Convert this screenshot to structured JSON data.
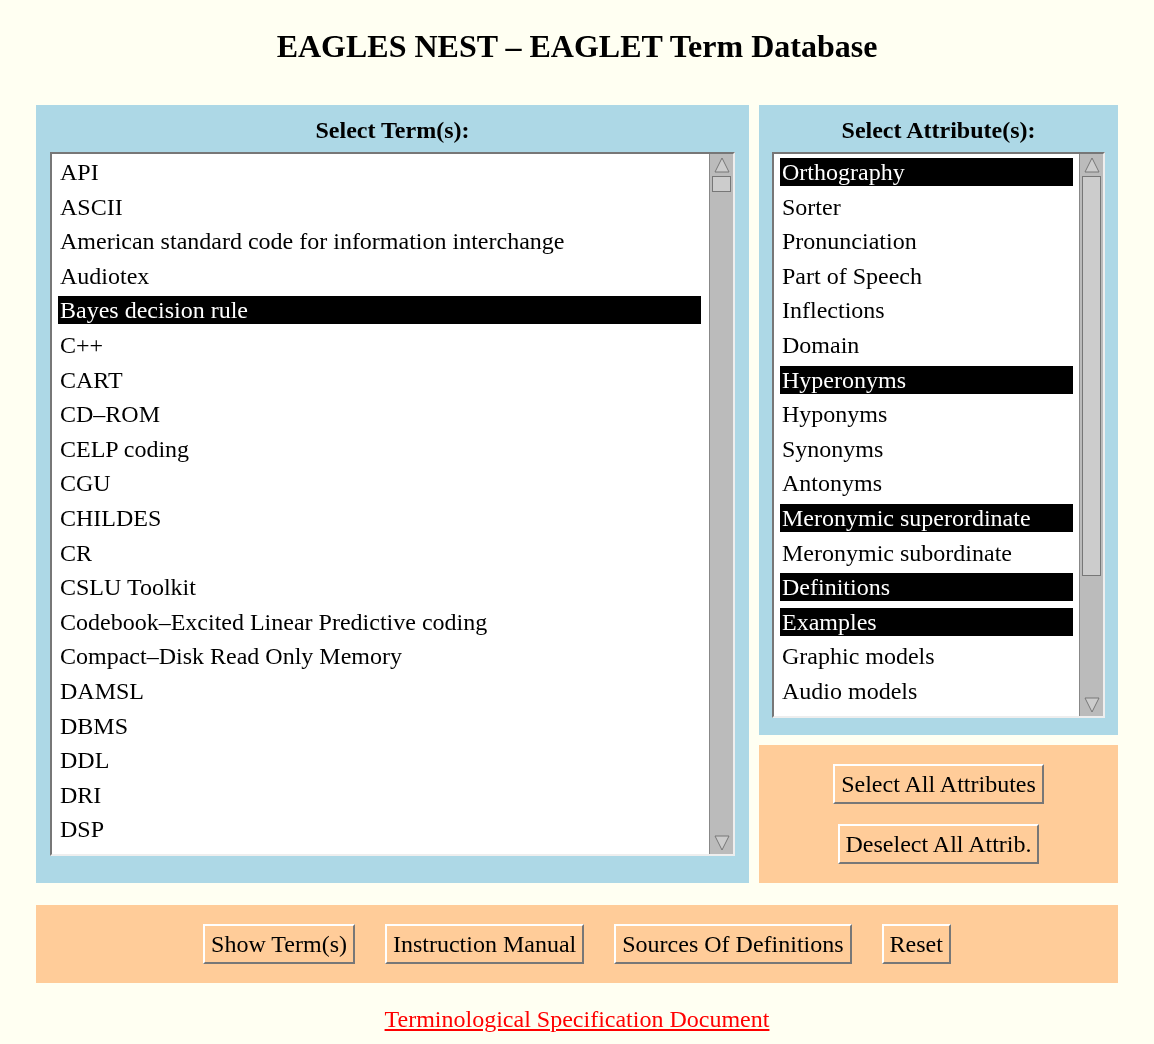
{
  "title": "EAGLES NEST – EAGLET Term Database",
  "terms": {
    "heading": "Select Term(s):",
    "items": [
      {
        "label": "API",
        "selected": false
      },
      {
        "label": "ASCII",
        "selected": false
      },
      {
        "label": "American standard code for information interchange",
        "selected": false
      },
      {
        "label": "Audiotex",
        "selected": false
      },
      {
        "label": "Bayes decision rule",
        "selected": true
      },
      {
        "label": "C++",
        "selected": false
      },
      {
        "label": "CART",
        "selected": false
      },
      {
        "label": "CD–ROM",
        "selected": false
      },
      {
        "label": "CELP coding",
        "selected": false
      },
      {
        "label": "CGU",
        "selected": false
      },
      {
        "label": "CHILDES",
        "selected": false
      },
      {
        "label": "CR",
        "selected": false
      },
      {
        "label": "CSLU Toolkit",
        "selected": false
      },
      {
        "label": "Codebook–Excited Linear Predictive coding",
        "selected": false
      },
      {
        "label": "Compact–Disk Read Only Memory",
        "selected": false
      },
      {
        "label": "DAMSL",
        "selected": false
      },
      {
        "label": "DBMS",
        "selected": false
      },
      {
        "label": "DDL",
        "selected": false
      },
      {
        "label": "DRI",
        "selected": false
      },
      {
        "label": "DSP",
        "selected": false
      }
    ]
  },
  "attributes": {
    "heading": "Select Attribute(s):",
    "items": [
      {
        "label": "Orthography",
        "selected": true
      },
      {
        "label": "Sorter",
        "selected": false
      },
      {
        "label": "Pronunciation",
        "selected": false
      },
      {
        "label": "Part of Speech",
        "selected": false
      },
      {
        "label": "Inflections",
        "selected": false
      },
      {
        "label": "Domain",
        "selected": false
      },
      {
        "label": "Hyperonyms",
        "selected": true
      },
      {
        "label": "Hyponyms",
        "selected": false
      },
      {
        "label": "Synonyms",
        "selected": false
      },
      {
        "label": "Antonyms",
        "selected": false
      },
      {
        "label": "Meronymic superordinate",
        "selected": true
      },
      {
        "label": "Meronymic subordinate",
        "selected": false
      },
      {
        "label": "Definitions",
        "selected": true
      },
      {
        "label": "Examples",
        "selected": true
      },
      {
        "label": "Graphic models",
        "selected": false
      },
      {
        "label": "Audio models",
        "selected": false
      }
    ]
  },
  "attribute_buttons": [
    "Select All Attributes",
    "Deselect All Attrib."
  ],
  "buttons": [
    "Show Term(s)",
    "Instruction Manual",
    "Sources Of Definitions",
    "Reset"
  ],
  "link": "Terminological Specification Document"
}
